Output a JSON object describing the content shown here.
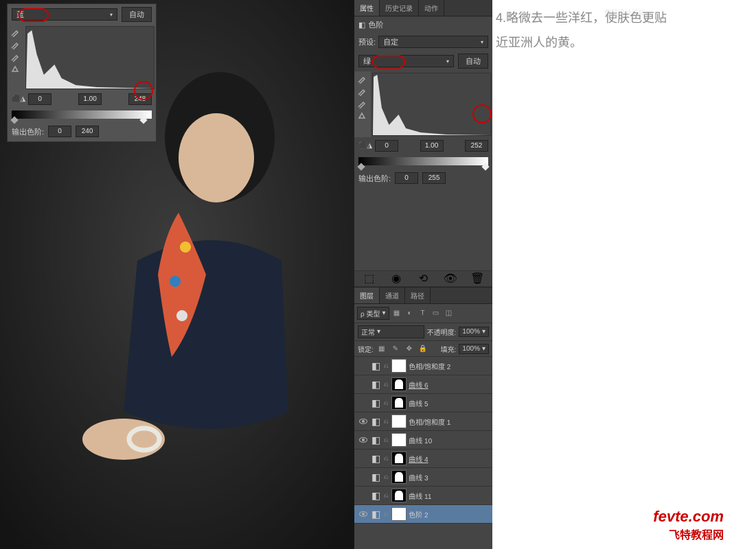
{
  "annotation": {
    "line1": "4.略微去一些洋红，使肤色更贴",
    "line2": "近亚洲人的黄。"
  },
  "watermark": {
    "logo": "fevte.com",
    "cn": "飞特教程网",
    "faint": "鹿铭设计论坛"
  },
  "levels_panel_1": {
    "channel": "蓝",
    "auto": "自动",
    "input_black": "0",
    "input_mid": "1.00",
    "input_white": "248",
    "output_label": "输出色阶:",
    "output_black": "0",
    "output_white": "240"
  },
  "properties_panel": {
    "tabs": [
      "属性",
      "历史记录",
      "动作"
    ],
    "adjustment_icon_label": "色阶",
    "preset_label": "预设:",
    "preset_value": "自定",
    "channel": "绿",
    "auto": "自动",
    "input_black": "0",
    "input_mid": "1.00",
    "input_white": "252",
    "output_label": "输出色阶:",
    "output_black": "0",
    "output_white": "255"
  },
  "layers_panel": {
    "tabs": [
      "图层",
      "通道",
      "路径"
    ],
    "filter_label": "ρ 类型",
    "blend_mode": "正常",
    "opacity_label": "不透明度:",
    "opacity_value": "100%",
    "lock_label": "锁定:",
    "fill_label": "填充:",
    "fill_value": "100%",
    "layers": [
      {
        "name": "色相/饱和度 2",
        "mask": "white",
        "selected": false,
        "visible": false
      },
      {
        "name": "曲线 6",
        "mask": "shape",
        "selected": false,
        "visible": false,
        "underline": true
      },
      {
        "name": "曲线 5",
        "mask": "shape",
        "selected": false,
        "visible": false
      },
      {
        "name": "色相/饱和度 1",
        "mask": "white",
        "selected": false,
        "visible": true
      },
      {
        "name": "曲线 10",
        "mask": "white",
        "selected": false,
        "visible": true
      },
      {
        "name": "曲线 4",
        "mask": "shape",
        "selected": false,
        "visible": false,
        "underline": true
      },
      {
        "name": "曲线 3",
        "mask": "shape",
        "selected": false,
        "visible": false
      },
      {
        "name": "曲线 11",
        "mask": "shape",
        "selected": false,
        "visible": false
      },
      {
        "name": "色阶 2",
        "mask": "white",
        "selected": true,
        "visible": true
      }
    ]
  }
}
